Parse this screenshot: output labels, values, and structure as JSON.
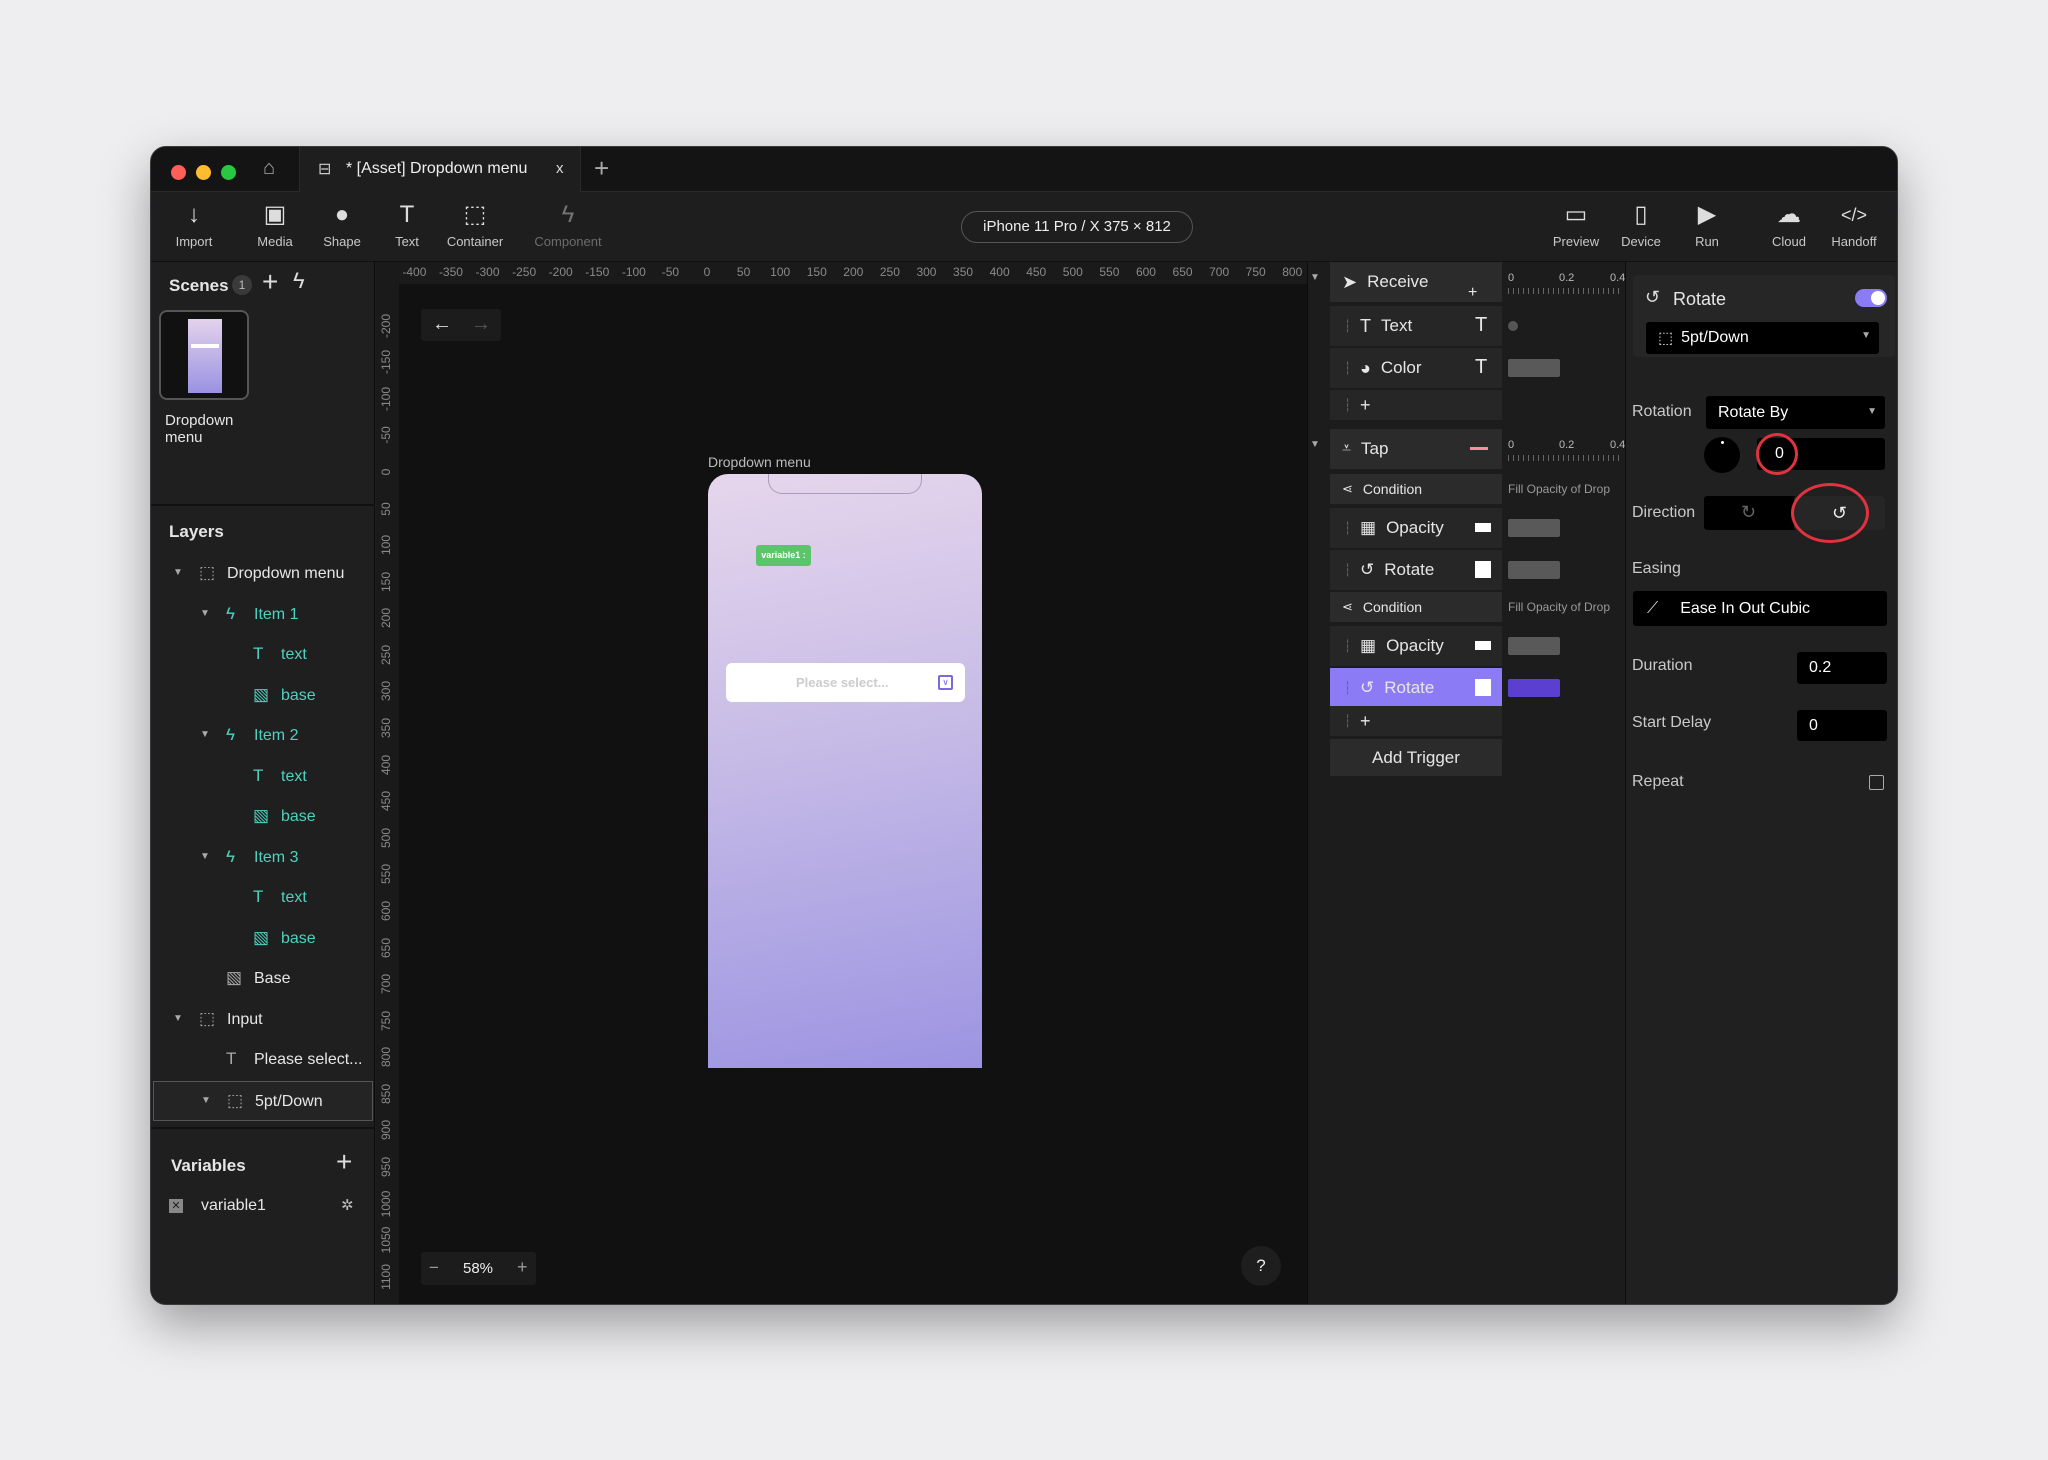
{
  "colors": {
    "accent": "#8b7cf6",
    "teal": "#4fd1bf",
    "selected_row": "#8b7cf6",
    "timeline_active": "#5b3fd0",
    "annotation": "#e0333f",
    "badge": "#5cc46a"
  },
  "tabs": {
    "home_icon": "home-icon",
    "active_tab": "* [Asset] Dropdown menu",
    "close": "x",
    "new_tab": "+"
  },
  "toolbar": {
    "left": [
      {
        "label": "Import",
        "icon": "↓"
      },
      {
        "label": "Media",
        "icon": "▣"
      },
      {
        "label": "Shape",
        "icon": "●"
      },
      {
        "label": "Text",
        "icon": "T"
      },
      {
        "label": "Container",
        "icon": "⬚"
      },
      {
        "label": "Component",
        "icon": "ϟ"
      }
    ],
    "device": "iPhone 11 Pro / X  375 × 812",
    "right": [
      {
        "label": "Preview",
        "icon": "▭"
      },
      {
        "label": "Device",
        "icon": "▯"
      },
      {
        "label": "Run",
        "icon": "▶"
      },
      {
        "label": "Cloud",
        "icon": "☁"
      },
      {
        "label": "Handoff",
        "icon": "</>"
      }
    ]
  },
  "scenes": {
    "title": "Scenes",
    "count": "1",
    "items": [
      {
        "label": "Dropdown menu"
      }
    ]
  },
  "layers": {
    "title": "Layers",
    "items": [
      {
        "label": "Dropdown menu",
        "level": 0,
        "icon": "container",
        "expand": true,
        "color": "#e6e6e6"
      },
      {
        "label": "Item 1",
        "level": 1,
        "icon": "component",
        "expand": true,
        "color": "#4fd1bf"
      },
      {
        "label": "text",
        "level": 2,
        "icon": "text",
        "expand": false,
        "color": "#4fd1bf"
      },
      {
        "label": "base",
        "level": 2,
        "icon": "image",
        "expand": false,
        "color": "#4fd1bf"
      },
      {
        "label": "Item 2",
        "level": 1,
        "icon": "component",
        "expand": true,
        "color": "#4fd1bf"
      },
      {
        "label": "text",
        "level": 2,
        "icon": "text",
        "expand": false,
        "color": "#4fd1bf"
      },
      {
        "label": "base",
        "level": 2,
        "icon": "image",
        "expand": false,
        "color": "#4fd1bf"
      },
      {
        "label": "Item 3",
        "level": 1,
        "icon": "component",
        "expand": true,
        "color": "#4fd1bf"
      },
      {
        "label": "text",
        "level": 2,
        "icon": "text",
        "expand": false,
        "color": "#4fd1bf"
      },
      {
        "label": "base",
        "level": 2,
        "icon": "image",
        "expand": false,
        "color": "#4fd1bf"
      },
      {
        "label": "Base",
        "level": 1,
        "icon": "image",
        "expand": false,
        "color": "#e6e6e6"
      },
      {
        "label": "Input",
        "level": 0,
        "icon": "container",
        "expand": true,
        "color": "#e6e6e6"
      },
      {
        "label": "Please select...",
        "level": 1,
        "icon": "text",
        "expand": false,
        "color": "#e6e6e6"
      },
      {
        "label": "5pt/Down",
        "level": 1,
        "icon": "container",
        "expand": true,
        "color": "#e6e6e6",
        "selected": true
      }
    ]
  },
  "variables": {
    "title": "Variables",
    "items": [
      {
        "label": "variable1"
      }
    ]
  },
  "canvas": {
    "ruler_x": [
      "-400",
      "-350",
      "-300",
      "-250",
      "-200",
      "-150",
      "-100",
      "-50",
      "0",
      "50",
      "100",
      "150",
      "200",
      "250",
      "300",
      "350",
      "400",
      "450",
      "500",
      "550",
      "600",
      "650",
      "700",
      "750",
      "800"
    ],
    "ruler_y": [
      "-200",
      "-150",
      "-100",
      "-50",
      "0",
      "50",
      "100",
      "150",
      "200",
      "250",
      "300",
      "350",
      "400",
      "450",
      "500",
      "550",
      "600",
      "650",
      "700",
      "750",
      "800",
      "850",
      "900",
      "950",
      "1000",
      "1050",
      "1100"
    ],
    "frame_label": "Dropdown menu",
    "badge": "variable1 :",
    "input_placeholder": "Please select...",
    "zoom": "58%",
    "zoom_minus": "−",
    "zoom_plus": "+",
    "help": "?"
  },
  "interactions": {
    "timeline_ticks": [
      "0",
      "0.2",
      "0.4"
    ],
    "receive": {
      "label": "Receive",
      "rows": [
        {
          "label": "Text",
          "icon": "text"
        },
        {
          "label": "Color",
          "icon": "color"
        }
      ]
    },
    "tap": {
      "label": "Tap",
      "groups": [
        {
          "condition": "Condition",
          "track_label": "Fill Opacity of Drop",
          "rows": [
            {
              "label": "Opacity"
            },
            {
              "label": "Rotate"
            }
          ]
        },
        {
          "condition": "Condition",
          "track_label": "Fill Opacity of Drop",
          "rows": [
            {
              "label": "Opacity"
            },
            {
              "label": "Rotate",
              "selected": true
            }
          ]
        }
      ]
    },
    "add": "+",
    "add_trigger": "Add Trigger"
  },
  "properties": {
    "title": "Rotate",
    "enabled": true,
    "target": "5pt/Down",
    "rotation_label": "Rotation",
    "rotation_mode": "Rotate By",
    "rotation_value": "0",
    "direction_label": "Direction",
    "direction": "counterclockwise",
    "easing_label": "Easing",
    "easing": "Ease In Out Cubic",
    "duration_label": "Duration",
    "duration": "0.2",
    "delay_label": "Start Delay",
    "delay": "0",
    "repeat_label": "Repeat",
    "repeat": false
  }
}
